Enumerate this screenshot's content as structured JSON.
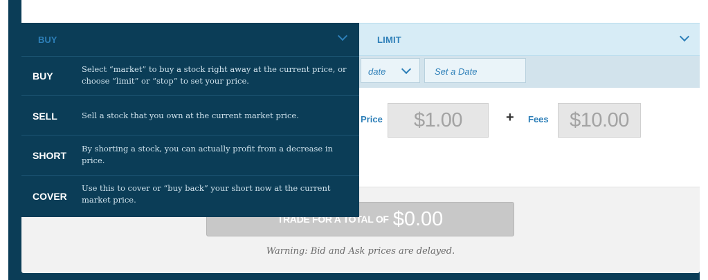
{
  "order_type": {
    "selected": "BUY",
    "options": [
      {
        "name": "BUY",
        "description": "Select “market” to buy a stock right away at the current price, or choose “limit” or “stop” to set your price."
      },
      {
        "name": "SELL",
        "description": "Sell a stock that you own at the current market price."
      },
      {
        "name": "SHORT",
        "description": "By shorting a stock, you can actually profit from a decrease in price."
      },
      {
        "name": "COVER",
        "description": "Use this to cover or “buy back” your short now at the current market price."
      }
    ]
  },
  "price_type": {
    "selected": "LIMIT"
  },
  "duration": {
    "select_value": "date",
    "set_date_placeholder": "Set a Date"
  },
  "price": {
    "label": "Price",
    "value": "$1.00"
  },
  "fees": {
    "label": "Fees",
    "value": "$10.00"
  },
  "operator": "+",
  "trade_button": {
    "label": "TRADE FOR A TOTAL OF",
    "amount": "$0.00"
  },
  "warning": "Warning: Bid and Ask prices are delayed.",
  "colors": {
    "dark": "#0b3d57",
    "accent": "#2d7fb8",
    "light_bar": "#d7ecf6"
  }
}
